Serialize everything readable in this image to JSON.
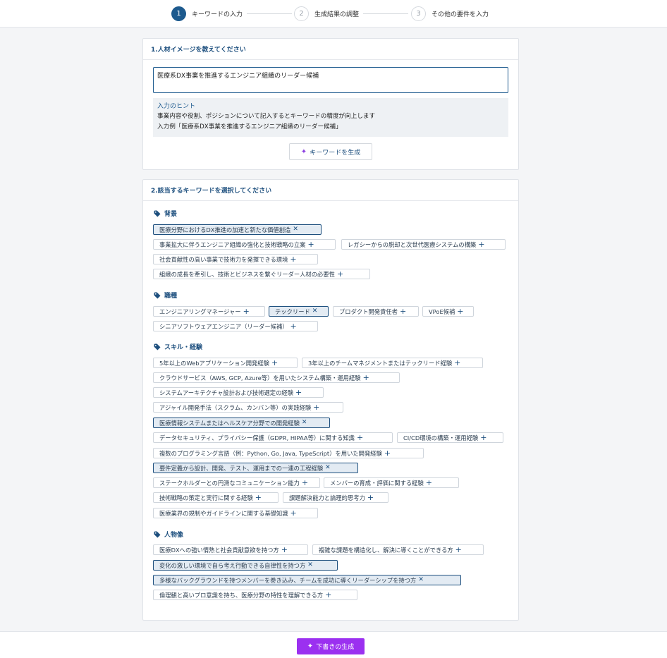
{
  "stepper": {
    "steps": [
      {
        "num": "1",
        "label": "キーワードの入力"
      },
      {
        "num": "2",
        "label": "生成結果の調整"
      },
      {
        "num": "3",
        "label": "その他の要件を入力"
      }
    ]
  },
  "card1": {
    "title": "1.人材イメージを教えてください",
    "input_value": "医療系DX事業を推進するエンジニア組織のリーダー候補",
    "hint_title": "入力のヒント",
    "hint_line1": "事業内容や役割、ポジションについて記入するとキーワードの精度が向上します",
    "hint_line2": "入力例「医療系DX事業を推進するエンジニア組織のリーダー候補」",
    "generate_label": "キーワードを生成"
  },
  "card2": {
    "title": "2.該当するキーワードを選択してください",
    "sections": [
      {
        "title": "背景",
        "chips": [
          {
            "label": "医療分野におけるDX推進の加速と新たな価値創造",
            "selected": true
          },
          {
            "label": "事業拡大に伴うエンジニア組織の強化と技術戦略の立案",
            "selected": false
          },
          {
            "label": "レガシーからの脱却と次世代医療システムの構築",
            "selected": false
          },
          {
            "label": "社会貢献性の高い事業で技術力を発揮できる環境",
            "selected": false
          },
          {
            "label": "組織の成長を牽引し、技術とビジネスを繋ぐリーダー人材の必要性",
            "selected": false
          }
        ]
      },
      {
        "title": "職種",
        "chips": [
          {
            "label": "エンジニアリングマネージャー",
            "selected": false
          },
          {
            "label": "テックリード",
            "selected": true
          },
          {
            "label": "プロダクト開発責任者",
            "selected": false
          },
          {
            "label": "VPoE候補",
            "selected": false
          },
          {
            "label": "シニアソフトウェアエンジニア（リーダー候補）",
            "selected": false
          }
        ]
      },
      {
        "title": "スキル・経験",
        "chips": [
          {
            "label": "5年以上のWebアプリケーション開発経験",
            "selected": false
          },
          {
            "label": "3年以上のチームマネジメントまたはテックリード経験",
            "selected": false
          },
          {
            "label": "クラウドサービス（AWS, GCP, Azure等）を用いたシステム構築・運用経験",
            "selected": false
          },
          {
            "label": "システムアーキテクチャ設計および技術選定の経験",
            "selected": false
          },
          {
            "label": "アジャイル開発手法（スクラム、カンバン等）の実践経験",
            "selected": false
          },
          {
            "label": "医療情報システムまたはヘルスケア分野での開発経験",
            "selected": true
          },
          {
            "label": "データセキュリティ、プライバシー保護（GDPR, HIPAA等）に関する知識",
            "selected": false
          },
          {
            "label": "CI/CD環境の構築・運用経験",
            "selected": false
          },
          {
            "label": "複数のプログラミング言語（例：Python, Go, Java, TypeScript）を用いた開発経験",
            "selected": false
          },
          {
            "label": "要件定義から設計、開発、テスト、運用までの一連の工程経験",
            "selected": true
          },
          {
            "label": "ステークホルダーとの円滑なコミュニケーション能力",
            "selected": false
          },
          {
            "label": "メンバーの育成・評価に関する経験",
            "selected": false
          },
          {
            "label": "技術戦略の策定と実行に関する経験",
            "selected": false
          },
          {
            "label": "課題解決能力と論理的思考力",
            "selected": false
          },
          {
            "label": "医療業界の規制やガイドラインに関する基礎知識",
            "selected": false
          }
        ]
      },
      {
        "title": "人物像",
        "chips": [
          {
            "label": "医療DXへの強い情熱と社会貢献意欲を持つ方",
            "selected": false
          },
          {
            "label": "複雑な課題を構造化し、解決に導くことができる方",
            "selected": false
          },
          {
            "label": "変化の激しい環境で自ら考え行動できる自律性を持つ方",
            "selected": true
          },
          {
            "label": "多様なバックグラウンドを持つメンバーを巻き込み、チームを成功に導くリーダーシップを持つ方",
            "selected": true
          },
          {
            "label": "倫理観と高いプロ意識を持ち、医療分野の特性を理解できる方",
            "selected": false
          }
        ]
      }
    ]
  },
  "footer": {
    "draft_label": "下書きの生成"
  },
  "colors": {
    "primary": "#1d5a8e",
    "accent_purple": "#9b30f0",
    "selected_chip_bg": "#e3ebf3"
  },
  "icons": {
    "section": "tag-icon",
    "generate": "sparkle-icon",
    "add": "plus-icon",
    "remove": "close-icon"
  }
}
